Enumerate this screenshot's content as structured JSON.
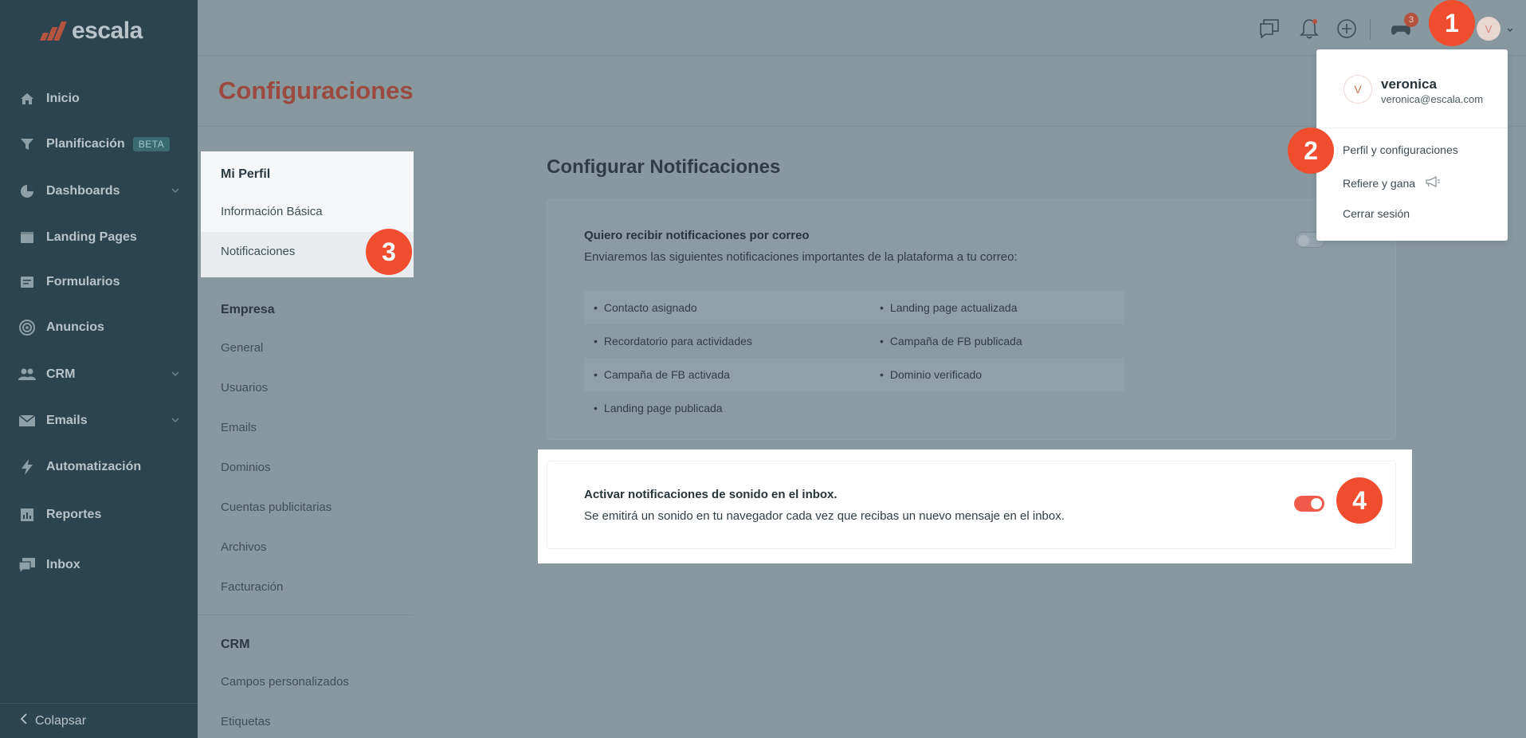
{
  "brand": {
    "logo_text": "escala",
    "accent": "#ef4d2e"
  },
  "sidebar": {
    "items": [
      {
        "label": "Inicio",
        "icon": "home-icon"
      },
      {
        "label": "Planificación",
        "icon": "filter-icon",
        "badge": "BETA"
      },
      {
        "label": "Dashboards",
        "icon": "pie-chart-icon",
        "expandable": true
      },
      {
        "label": "Landing Pages",
        "icon": "landing-page-icon"
      },
      {
        "label": "Formularios",
        "icon": "form-icon"
      },
      {
        "label": "Anuncios",
        "icon": "target-icon"
      },
      {
        "label": "CRM",
        "icon": "people-icon",
        "expandable": true
      },
      {
        "label": "Emails",
        "icon": "mail-icon",
        "expandable": true
      },
      {
        "label": "Automatización",
        "icon": "lightning-icon"
      },
      {
        "label": "Reportes",
        "icon": "report-icon"
      },
      {
        "label": "Inbox",
        "icon": "chat-icon"
      }
    ],
    "collapse_label": "Colapsar"
  },
  "topbar": {
    "notifications_badge": "3",
    "avatar_initial": "V"
  },
  "page": {
    "title": "Configuraciones"
  },
  "settings_nav": {
    "mi_perfil": {
      "heading": "Mi Perfil",
      "items": [
        "Información Básica",
        "Notificaciones"
      ]
    },
    "empresa": {
      "heading": "Empresa",
      "items": [
        "General",
        "Usuarios",
        "Emails",
        "Dominios",
        "Cuentas publicitarias",
        "Archivos",
        "Facturación"
      ]
    },
    "crm": {
      "heading": "CRM",
      "items": [
        "Campos personalizados",
        "Etiquetas"
      ]
    }
  },
  "main": {
    "title": "Configurar Notificaciones",
    "email_card": {
      "title": "Quiero recibir notificaciones por correo",
      "description": "Enviaremos las siguientes notificaciones importantes de la plataforma a tu correo:",
      "enabled": false,
      "notifications": [
        [
          "Contacto asignado",
          "Landing page actualizada"
        ],
        [
          "Recordatorio para actividades",
          "Campaña de FB publicada"
        ],
        [
          "Campaña de FB activada",
          "Dominio verificado"
        ],
        [
          "Landing page publicada",
          ""
        ]
      ]
    },
    "sound_card": {
      "title": "Activar notificaciones de sonido en el inbox.",
      "description": "Se emitirá un sonido en tu navegador cada vez que recibas un nuevo mensaje en el inbox.",
      "enabled": true,
      "toggle_color": "#ef5a4a"
    }
  },
  "user_menu": {
    "initial": "V",
    "name": "veronica",
    "email": "veronica@escala.com",
    "items": [
      "Perfil y configuraciones",
      "Refiere y gana",
      "Cerrar sesión"
    ]
  },
  "steps": [
    "1",
    "2",
    "3",
    "4"
  ]
}
